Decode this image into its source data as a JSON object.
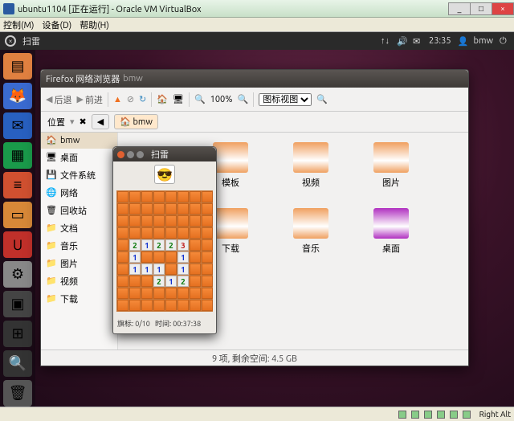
{
  "vbox": {
    "title": "ubuntu1104 [正在运行] - Oracle VM VirtualBox",
    "menu": [
      "控制(M)",
      "设备(D)",
      "帮助(H)"
    ],
    "rightalt": "Right Alt",
    "winbtns": {
      "min": "_",
      "max": "□",
      "close": "×"
    }
  },
  "ubuntu": {
    "topbar": {
      "app": "扫雷",
      "time": "23:35",
      "user": "bmw",
      "icons": {
        "net": "↑↓",
        "vol": "🔊",
        "mail": "✉",
        "power": "⏻"
      }
    },
    "launcher": [
      {
        "name": "files",
        "bg": "#e08040",
        "glyph": "▤"
      },
      {
        "name": "firefox",
        "bg": "#3a6ad0",
        "glyph": "🦊"
      },
      {
        "name": "thunderbird",
        "bg": "#2860c0",
        "glyph": "✉"
      },
      {
        "name": "calc",
        "bg": "#1a9a4a",
        "glyph": "▦"
      },
      {
        "name": "writer",
        "bg": "#d05030",
        "glyph": "≡"
      },
      {
        "name": "impress",
        "bg": "#d88838",
        "glyph": "▭"
      },
      {
        "name": "software",
        "bg": "#c0302a",
        "glyph": "U"
      },
      {
        "name": "settings",
        "bg": "#888",
        "glyph": "⚙"
      },
      {
        "name": "workspaces",
        "bg": "#444",
        "glyph": "▣"
      },
      {
        "name": "apps",
        "bg": "#333",
        "glyph": "⊞"
      },
      {
        "name": "search",
        "bg": "#333",
        "glyph": "🔍"
      },
      {
        "name": "trash",
        "bg": "#555",
        "glyph": "🗑"
      }
    ]
  },
  "nautilus": {
    "title_prefix": "Firefox 网络浏览器",
    "title_path": "bmw",
    "toolbar": {
      "back": "后退",
      "forward": "前进",
      "zoom": "100%",
      "view_select": "图标视图"
    },
    "location": {
      "label": "位置",
      "crumb": "bmw"
    },
    "sidebar": [
      {
        "icon": "🏠",
        "label": "bmw"
      },
      {
        "icon": "🖥",
        "label": "桌面"
      },
      {
        "icon": "💾",
        "label": "文件系统"
      },
      {
        "icon": "🌐",
        "label": "网络"
      },
      {
        "icon": "🗑",
        "label": "回收站"
      },
      {
        "icon": "📁",
        "label": "文档"
      },
      {
        "icon": "📁",
        "label": "音乐"
      },
      {
        "icon": "📁",
        "label": "图片"
      },
      {
        "icon": "📁",
        "label": "视频"
      },
      {
        "icon": "📁",
        "label": "下载"
      }
    ],
    "grid": [
      {
        "label": "模板",
        "bg": "#f0a060"
      },
      {
        "label": "视频",
        "bg": "#f0a060"
      },
      {
        "label": "图片",
        "bg": "#f0a060"
      },
      {
        "label": "下载",
        "bg": "#f0a060"
      },
      {
        "label": "音乐",
        "bg": "#f0a060"
      },
      {
        "label": "桌面",
        "bg": "#b030c0"
      }
    ],
    "status": "9 项,  剩余空间:  4.5 GB"
  },
  "mines": {
    "title": "扫雷",
    "face": "😎",
    "status_flags_label": "旗标:",
    "status_flags": "0/10",
    "status_time_label": "时间:",
    "status_time": "00:37:38",
    "board": [
      [
        0,
        0,
        0,
        0,
        0,
        0,
        0,
        0
      ],
      [
        0,
        0,
        0,
        0,
        0,
        0,
        0,
        0
      ],
      [
        0,
        0,
        0,
        0,
        0,
        0,
        0,
        0
      ],
      [
        0,
        0,
        0,
        0,
        0,
        0,
        0,
        0
      ],
      [
        0,
        "2",
        "1",
        "2",
        "2",
        "3",
        0,
        0
      ],
      [
        0,
        "1",
        0,
        0,
        0,
        "1",
        0,
        0
      ],
      [
        0,
        "1",
        "1",
        "1",
        0,
        "1",
        0,
        0
      ],
      [
        0,
        0,
        0,
        "2",
        "1",
        "2",
        0,
        0
      ],
      [
        0,
        0,
        0,
        0,
        0,
        0,
        0,
        0
      ],
      [
        0,
        0,
        0,
        0,
        0,
        0,
        0,
        0
      ]
    ]
  }
}
